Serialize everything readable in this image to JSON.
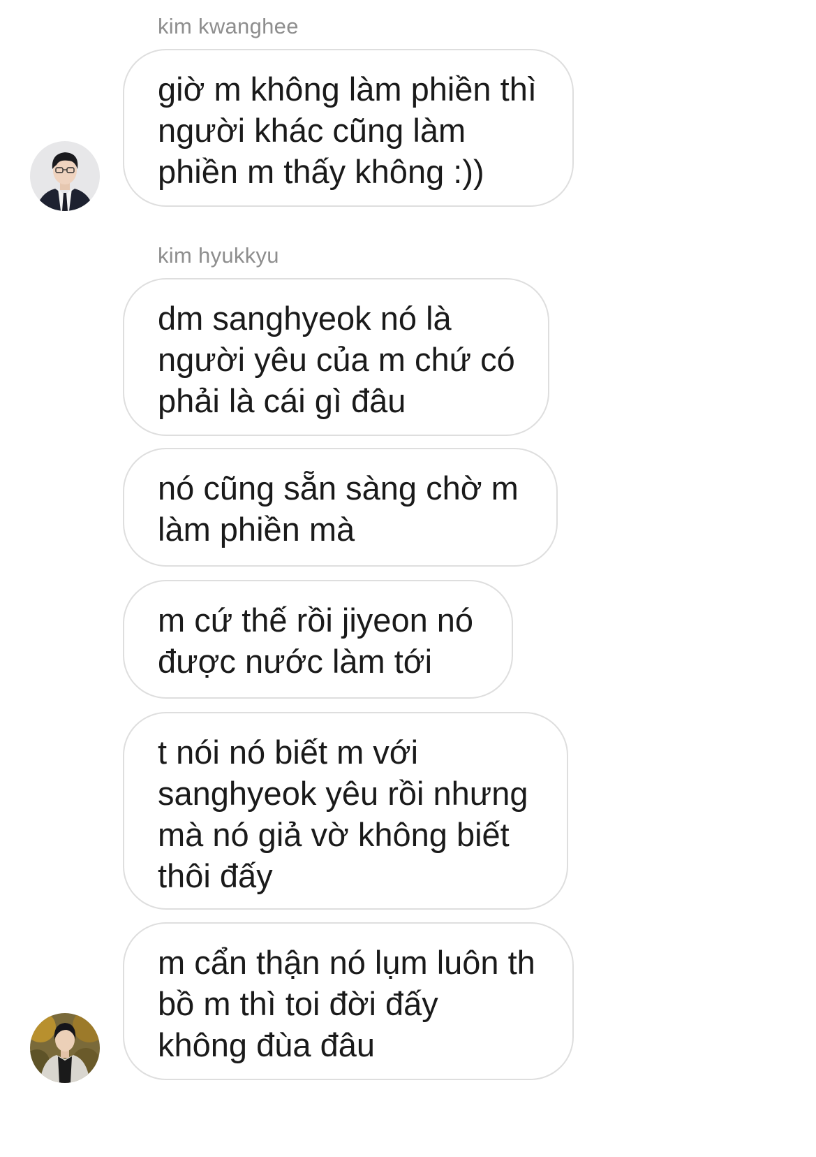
{
  "conversation": {
    "groups": [
      {
        "sender": "kim kwanghee",
        "messages": [
          "giờ m không làm phiền thì\nngười khác cũng làm\nphiền m thấy không :))"
        ]
      },
      {
        "sender": "kim hyukkyu",
        "messages": [
          "dm sanghyeok nó là\nngười yêu của m chứ có\nphải là cái gì đâu",
          "nó cũng sẵn sàng chờ m\nlàm phiền mà",
          "m cứ thế rồi jiyeon nó\nđược nước làm tới",
          "t nói nó biết m với\nsanghyeok yêu rồi nhưng\nmà nó giả vờ không biết\nthôi đấy",
          "m cẩn thận nó lụm luôn th\nbồ m thì toi đời đấy\nkhông đùa đâu"
        ]
      }
    ]
  },
  "colors": {
    "background": "#ffffff",
    "bubble_border": "#dedede",
    "sender_name": "#8e8e8e",
    "message_text": "#1a1a1a"
  },
  "icons": {
    "avatar_1": "avatar-photo-kim-kwanghee",
    "avatar_2": "avatar-photo-kim-hyukkyu"
  }
}
